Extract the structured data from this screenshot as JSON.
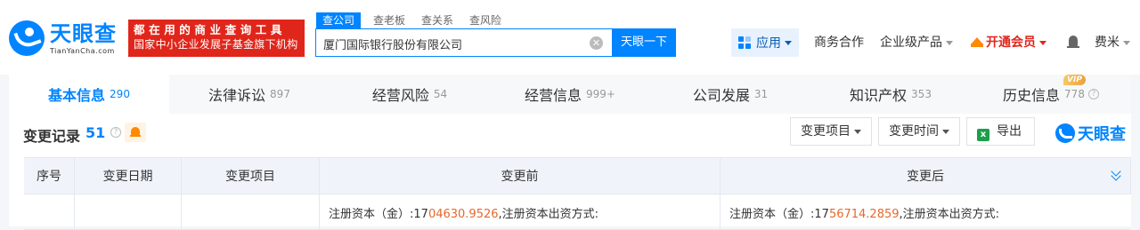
{
  "header": {
    "logo_cn": "天眼查",
    "logo_en": "TianYanCha.com",
    "promo_line1": "都在用的商业查询工具",
    "promo_line2": "国家中小企业发展子基金旗下机构",
    "search_tabs": [
      "查公司",
      "查老板",
      "查关系",
      "查风险"
    ],
    "search_value": "厦门国际银行股份有限公司",
    "search_button": "天眼一下",
    "nav": {
      "apps": "应用",
      "business": "商务合作",
      "enterprise": "企业级产品",
      "vip": "开通会员",
      "user": "费米"
    }
  },
  "tabs": [
    {
      "label": "基本信息",
      "count": "290"
    },
    {
      "label": "法律诉讼",
      "count": "897"
    },
    {
      "label": "经营风险",
      "count": "54"
    },
    {
      "label": "经营信息",
      "count": "999+"
    },
    {
      "label": "公司发展",
      "count": "31"
    },
    {
      "label": "知识产权",
      "count": "353"
    },
    {
      "label": "历史信息",
      "count": "778"
    }
  ],
  "vip_badge": "VIP",
  "section": {
    "title": "变更记录",
    "count": "51",
    "filter_item": "变更项目",
    "filter_time": "变更时间",
    "export": "导出",
    "export_icon_letter": "x",
    "watermark": "天眼查"
  },
  "table": {
    "columns": [
      "序号",
      "变更日期",
      "变更项目",
      "变更前",
      "变更后"
    ],
    "row1": {
      "before_prefix": "注册资本（金）:17",
      "before_highlight": "04630.9526",
      "before_suffix": ",注册资本出资方式:",
      "after_prefix": "注册资本（金）:17",
      "after_highlight": "56714.2859",
      "after_suffix": ",注册资本出资方式:"
    }
  }
}
